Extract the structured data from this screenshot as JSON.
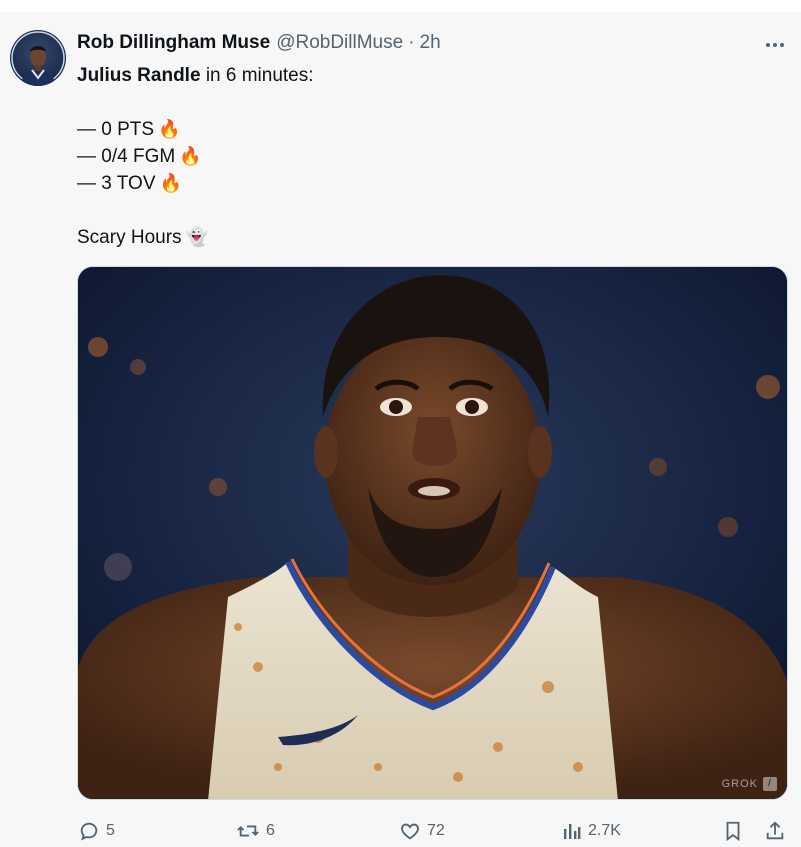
{
  "tweet": {
    "author_name": "Rob Dillingham Muse",
    "handle": "@RobDillMuse",
    "separator": "·",
    "time": "2h",
    "lines": {
      "subject": "Julius Randle",
      "subject_rest": "in 6 minutes:",
      "stat1": "— 0 PTS",
      "stat2": "— 0/4 FGM",
      "stat3": "— 3 TOV",
      "closing": "Scary Hours"
    },
    "emojis": {
      "fire": "🔥",
      "ghost": "👻"
    },
    "media": {
      "watermark": "GROK"
    },
    "actions": {
      "replies": "5",
      "reposts": "6",
      "likes": "72",
      "views": "2.7K"
    }
  },
  "colors": {
    "text": "#0f1419",
    "muted": "#536471",
    "background": "#f7f7f7"
  },
  "icons": [
    "more-icon",
    "reply-icon",
    "repost-icon",
    "like-icon",
    "views-icon",
    "bookmark-icon",
    "share-icon"
  ]
}
